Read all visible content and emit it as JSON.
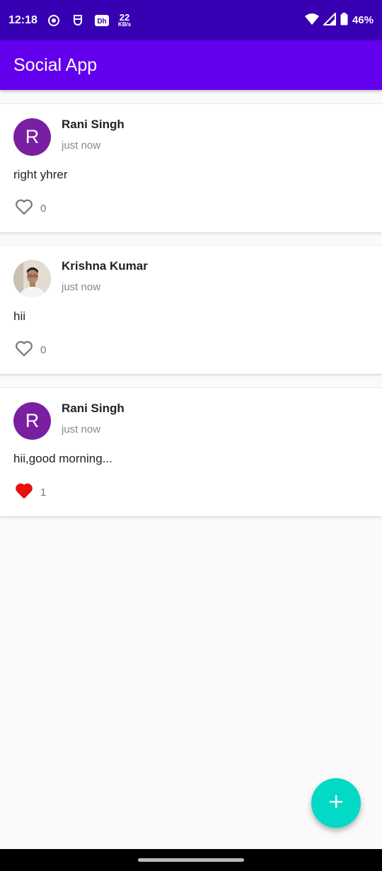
{
  "status_bar": {
    "time": "12:18",
    "speed_value": "22",
    "speed_unit": "KB/s",
    "battery": "46%",
    "icons": [
      "hotspot-icon",
      "shield-icon",
      "dh-app-icon",
      "wifi-icon",
      "signal-icon",
      "battery-icon"
    ]
  },
  "app_bar": {
    "title": "Social App",
    "color": "#6200ee"
  },
  "posts": [
    {
      "author": "Rani Singh",
      "avatar_letter": "R",
      "time": "just now",
      "content": "right yhrer",
      "likes": "0",
      "liked": false
    },
    {
      "author": "Krishna Kumar",
      "avatar_letter": "",
      "time": "just now",
      "content": "hii",
      "likes": "0",
      "liked": false
    },
    {
      "author": "Rani Singh",
      "avatar_letter": "R",
      "time": "just now",
      "content": "hii,good morning...",
      "likes": "1",
      "liked": true
    }
  ],
  "fab": {
    "icon": "plus-icon",
    "color": "#03dac5"
  },
  "colors": {
    "status_bar": "#3700b3",
    "avatar": "#7b1fa2",
    "like_active": "#e81010",
    "like_inactive": "#777777"
  }
}
